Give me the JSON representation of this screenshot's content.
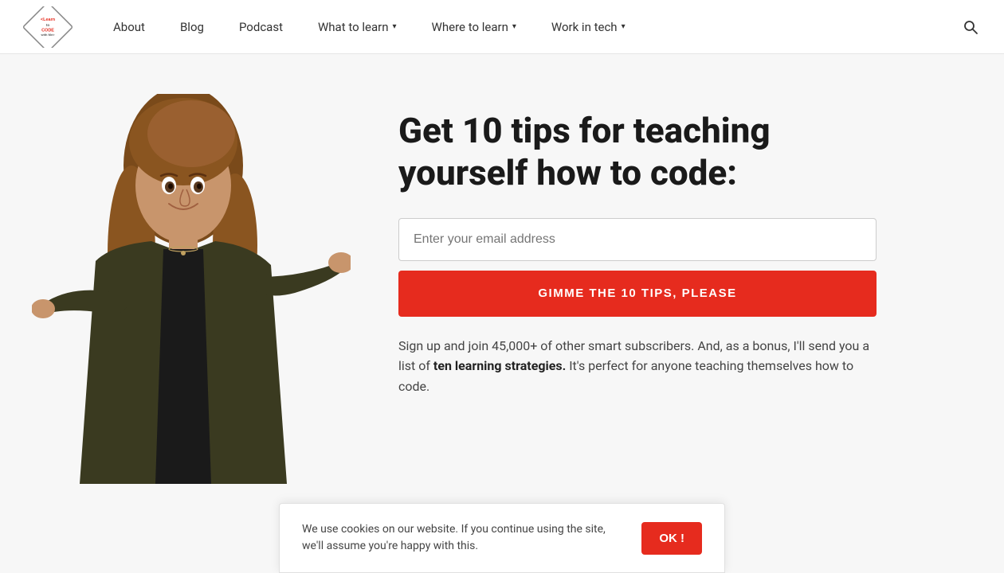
{
  "nav": {
    "logo_alt": "Learn to Code With Me",
    "links": [
      {
        "label": "About",
        "has_dropdown": false,
        "id": "about"
      },
      {
        "label": "Blog",
        "has_dropdown": false,
        "id": "blog"
      },
      {
        "label": "Podcast",
        "has_dropdown": false,
        "id": "podcast"
      },
      {
        "label": "What to learn",
        "has_dropdown": true,
        "id": "what-to-learn"
      },
      {
        "label": "Where to learn",
        "has_dropdown": true,
        "id": "where-to-learn"
      },
      {
        "label": "Work in tech",
        "has_dropdown": true,
        "id": "work-in-tech"
      }
    ]
  },
  "hero": {
    "title": "Get 10 tips for teaching yourself how to code:",
    "email_placeholder": "Enter your email address",
    "cta_label": "GIMME THE 10 TIPS, PLEASE",
    "subtext_before": "Sign up and join 45,000+ of other smart subscribers. And, as a bonus, I'll send you a list of ",
    "subtext_bold": "ten learning strategies.",
    "subtext_after": " It's perfect for anyone teaching themselves how to code."
  },
  "cookie": {
    "message": "We use cookies on our website. If you continue using the site, we'll assume you're happy with this.",
    "ok_label": "OK !"
  },
  "colors": {
    "accent": "#e62b1e",
    "nav_bg": "#ffffff",
    "body_bg": "#f7f7f7",
    "text_dark": "#1a1a1a",
    "text_mid": "#444444"
  }
}
